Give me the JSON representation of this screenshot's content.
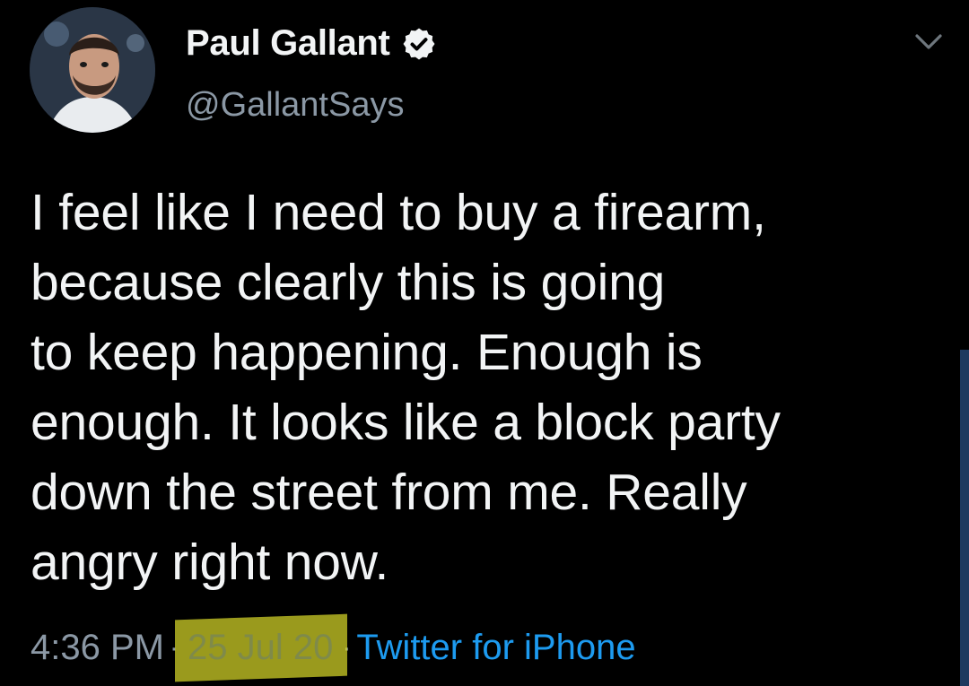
{
  "author": {
    "display_name": "Paul Gallant",
    "handle": "@GallantSays",
    "verified": true,
    "avatar_icon": "profile-photo"
  },
  "tweet": {
    "lines": [
      "I feel like I need to buy a firearm,",
      "because clearly this is going",
      "to keep happening. Enough is",
      "enough. It looks like a block party",
      "down the street from me. Really",
      "angry right now."
    ]
  },
  "meta": {
    "time": "4:36 PM",
    "separator": "·",
    "date": "25 Jul 20",
    "source": "Twitter for iPhone"
  },
  "colors": {
    "background": "#000000",
    "text": "#f2f4f5",
    "muted": "#8b98a5",
    "link": "#1d9bf0",
    "highlight": "#d6d628"
  },
  "icons": {
    "verified": "verified-badge-icon",
    "more": "chevron-down-icon"
  }
}
